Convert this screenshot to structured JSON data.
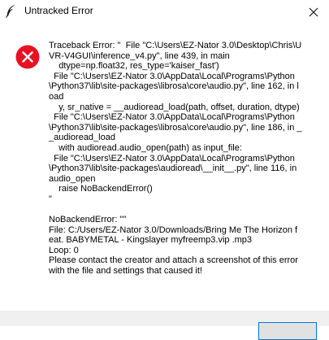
{
  "window": {
    "title": "Untracked Error",
    "app_icon": "feather-icon",
    "close_icon": "close-icon"
  },
  "dialog": {
    "icon": "error-icon",
    "icon_color": "#e81123",
    "message": "Traceback Error: \"  File \"C:\\Users\\EZ-Nator 3.0\\Desktop\\Chris\\UVR-V4GUI\\inference_v4.py\", line 439, in main\n    dtype=np.float32, res_type='kaiser_fast')\n  File \"C:\\Users\\EZ-Nator 3.0\\AppData\\Local\\Programs\\Python\\Python37\\lib\\site-packages\\librosa\\core\\audio.py\", line 162, in load\n    y, sr_native = __audioread_load(path, offset, duration, dtype)\n  File \"C:\\Users\\EZ-Nator 3.0\\AppData\\Local\\Programs\\Python\\Python37\\lib\\site-packages\\librosa\\core\\audio.py\", line 186, in __audioread_load\n    with audioread.audio_open(path) as input_file:\n  File \"C:\\Users\\EZ-Nator 3.0\\AppData\\Local\\Programs\\Python\\Python37\\lib\\site-packages\\audioread\\__init__.py\", line 116, in audio_open\n    raise NoBackendError()\n\"\n\nNoBackendError: \"\"\nFile: C:/Users/EZ-Nator 3.0/Downloads/Bring Me The Horizon feat. BABYMETAL - Kingslayer myfreemp3.vip .mp3\nLoop: 0\nPlease contact the creator and attach a screenshot of this error with the file and settings that caused it!"
  },
  "footer": {
    "ok_button_color": "#0078d7"
  }
}
